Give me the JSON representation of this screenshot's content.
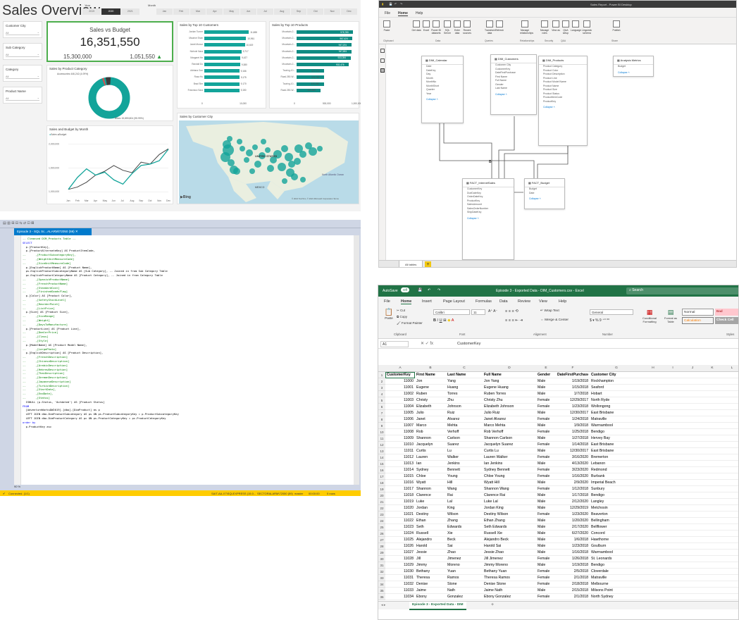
{
  "dashboard": {
    "title": "Sales Overview",
    "year_label": "Year",
    "years": [
      "2019",
      "2020",
      "2021"
    ],
    "year_selected": "2020",
    "month_label": "Month",
    "months": [
      "Jan",
      "Feb",
      "Mar",
      "Apr",
      "May",
      "Jun",
      "Jul",
      "Aug",
      "Sep",
      "Oct",
      "Nov",
      "Dec"
    ],
    "filters": [
      {
        "label": "Customer City",
        "value": "All"
      },
      {
        "label": "Sub Category",
        "value": "All"
      },
      {
        "label": "Category",
        "value": "All"
      },
      {
        "label": "Product Name",
        "value": "All"
      }
    ],
    "kpi": {
      "title": "Sales vs Budget",
      "value": "16,351,550",
      "left": "15,300,000",
      "right": "1,051,550"
    },
    "donut": {
      "title": "Sales by Product Category",
      "label_top": "Accessories 446,242 (4.09%)",
      "label_bottom": "Bikes 15,859,804 (95.99%)"
    },
    "top_customers": {
      "title": "Sales by Top 10 Customers",
      "names": [
        "Jordan Turner",
        "Maurice Shan",
        "Janet Munoz",
        "Nichole Nara",
        "Margaret He",
        "Randall Do",
        "Adriana Gon",
        "Rosa Hu",
        "Brad She",
        "Francisco Sara"
      ],
      "labels": [
        "11,688",
        "10,961",
        "10,619",
        "9,717",
        "9,427",
        "9,380",
        "9,166",
        "9,175",
        "9,170",
        "9,150"
      ],
      "values": [
        11688,
        10961,
        10619,
        9717,
        9427,
        9380,
        9166,
        9175,
        9170,
        9150
      ],
      "axis": [
        "0",
        "10,000"
      ]
    },
    "top_products": {
      "title": "Sales by Top 10 Products",
      "names": [
        "Mountain-2...",
        "Mountain-2...",
        "Mountain-2...",
        "Mountain-2...",
        "Mountain-2...",
        "Mountain-2...",
        "Touring-10...",
        "Road-350-W...",
        "Touring-10...",
        "Road-350-W..."
      ],
      "labels": [
        "978,780",
        "967,424",
        "947,201",
        "947,651",
        "933,394",
        "902,476",
        "477,772",
        "474,790",
        "470,940",
        "409,660"
      ],
      "values": [
        978780,
        967424,
        947201,
        947651,
        933394,
        902476,
        477772,
        474790,
        470940,
        409660
      ],
      "axis": [
        "0",
        "500,000",
        "1,000,000"
      ]
    },
    "line": {
      "title": "Sales and Budget by Month",
      "legend": [
        "Sales",
        "Budget"
      ],
      "y_ticks": [
        "2,000,000",
        "1,500,000",
        "1,000,000"
      ],
      "sales": [
        1050000,
        1300000,
        1480000,
        1350000,
        1410000,
        1250000,
        1160000,
        1380000,
        1550000,
        1580000,
        1650000,
        1890000
      ],
      "budget": [
        1050000,
        1100000,
        1200000,
        1350000,
        1430000,
        1550000,
        1450000,
        1400000,
        1620000,
        1580000,
        1780000,
        1900000
      ]
    },
    "map": {
      "title": "Sales by Customer City",
      "country": "UNITED STATES",
      "mexico": "MEXICO",
      "ocean": "North Atlantic Ocean",
      "brand": "Bing",
      "copyright": "© 2021 TomTom, © 2021 Microsoft Corporation Terms"
    }
  },
  "powerbi": {
    "window_title": "Sales Report - Power BI Desktop",
    "menu": [
      "File",
      "Home",
      "Help"
    ],
    "ribbon": [
      "Paste",
      "Get data",
      "Excel",
      "Power BI datasets",
      "SQL Server",
      "Enter data",
      "Recent sources",
      "Transform data",
      "Refresh",
      "Manage relationships",
      "Manage roles",
      "View as",
      "Q&A setup",
      "Language",
      "Linguistic schema",
      "Publish"
    ],
    "groups": [
      "Clipboard",
      "Data",
      "Queries",
      "Relationships",
      "Security",
      "Q&A",
      "Share"
    ],
    "tables": [
      {
        "name": "DIM_Calendar",
        "fields": [
          "Date",
          "DateKey",
          "Day",
          "Month",
          "MonthNo",
          "MonthShort",
          "Quarter",
          "Year"
        ]
      },
      {
        "name": "DIM_Customers",
        "fields": [
          "Customer City",
          "CustomerKey",
          "DateFirstPurchase",
          "First Name",
          "Full Name",
          "Gender",
          "Last Name"
        ]
      },
      {
        "name": "DIM_Products",
        "fields": [
          "Product Category",
          "Product Color",
          "Product Description",
          "Product Line",
          "Product Model Name",
          "Product Name",
          "Product Size",
          "Product Status",
          "ProductItemCode",
          "ProductKey"
        ]
      },
      {
        "name": "Analysis Metrics",
        "fields": [
          "Budget"
        ]
      },
      {
        "name": "FACT_InternetSales",
        "fields": [
          "CustomerKey",
          "DueDateKey",
          "OrderDateKey",
          "ProductKey",
          "SalesAmount",
          "SalesOrderNumber",
          "ShipDateKey"
        ]
      },
      {
        "name": "FACT_Budget",
        "fields": [
          "Budget",
          "Date"
        ]
      }
    ],
    "collapse": "Collapse",
    "tab": "All tables",
    "add_tab": "+"
  },
  "ssms": {
    "tab": "Episode 3 - SQL Sc...ALARM\\72050 (59)",
    "zoom": "90 %",
    "status_left": "Connected. (1/1)",
    "status_server": "SAIT-AA-X7\\SQLEXPRESS (15.0...",
    "status_user": "SECTORALARM\\72050 (59)",
    "status_db": "master",
    "status_time": "00:00:00",
    "status_rows": "0 rows",
    "code": [
      [
        "gr",
        "-- Cleansed DIM_Products Table --"
      ],
      [
        "kw",
        "SELECT"
      ],
      [
        "",
        "  p.[ProductKey],"
      ],
      [
        "",
        "  p.[ProductAlternateKey] AS ProductItemCode,"
      ],
      [
        "gr",
        "--      ,[ProductSubcategoryKey],"
      ],
      [
        "gr",
        "--      ,[WeightUnitMeasureCode]"
      ],
      [
        "gr",
        "--      ,[SizeUnitMeasureCode]"
      ],
      [
        "",
        "  p.[EnglishProductName] AS [Product Name],"
      ],
      [
        "",
        "  ps.EnglishProductSubcategoryName AS [Sub Category], -- Joined in from Sub Category Table"
      ],
      [
        "",
        "  pc.EnglishProductCategoryName AS [Product Category], -- Joined in from Category Table"
      ],
      [
        "gr",
        "--      ,[SpanishProductName]"
      ],
      [
        "gr",
        "--      ,[FrenchProductName]"
      ],
      [
        "gr",
        "--      ,[StandardCost]"
      ],
      [
        "gr",
        "--      ,[FinishedGoodsFlag]"
      ],
      [
        "",
        "  p.[Color] AS [Product Color],"
      ],
      [
        "gr",
        "--      ,[SafetyStockLevel]"
      ],
      [
        "gr",
        "--      ,[ReorderPoint]"
      ],
      [
        "gr",
        "--      ,[ListPrice]"
      ],
      [
        "",
        "  p.[Size] AS [Product Size],"
      ],
      [
        "gr",
        "--      ,[SizeRange]"
      ],
      [
        "gr",
        "--      ,[Weight]"
      ],
      [
        "gr",
        "--      ,[DaysToManufacture]"
      ],
      [
        "",
        "  p.[ProductLine] AS [Product Line],"
      ],
      [
        "gr",
        "--      ,[DealerPrice]"
      ],
      [
        "gr",
        "--      ,[Class]"
      ],
      [
        "gr",
        "--      ,[Style]"
      ],
      [
        "",
        "  p.[ModelName] AS [Product Model Name],"
      ],
      [
        "gr",
        "--      ,[LargePhoto]"
      ],
      [
        "",
        "  p.[EnglishDescription] AS [Product Description],"
      ],
      [
        "gr",
        "--      ,[FrenchDescription]"
      ],
      [
        "gr",
        "--      ,[ChineseDescription]"
      ],
      [
        "gr",
        "--      ,[ArabicDescription]"
      ],
      [
        "gr",
        "--      ,[HebrewDescription]"
      ],
      [
        "gr",
        "--      ,[ThaiDescription]"
      ],
      [
        "gr",
        "--      ,[GermanDescription]"
      ],
      [
        "gr",
        "--      ,[JapaneseDescription]"
      ],
      [
        "gr",
        "--      ,[TurkishDescription]"
      ],
      [
        "gr",
        "--      ,[StartDate],"
      ],
      [
        "gr",
        "--      ,[EndDate],"
      ],
      [
        "gr",
        "--      ,[Status]"
      ],
      [
        "",
        "  ISNULL (p.Status, 'Outdated') AS [Product Status]"
      ],
      [
        "kw",
        "FROM"
      ],
      [
        "",
        "  [AdventureWorksDW2019].[dbo].[DimProduct] as p"
      ],
      [
        "",
        "  LEFT JOIN dbo.DimProductSubcategory AS ps ON ps.ProductSubcategoryKey = p.ProductSubcategoryKey"
      ],
      [
        "",
        "  LEFT JOIN dbo.DimProductCategory AS pc ON ps.ProductCategoryKey = pc.ProductCategoryKey"
      ],
      [
        "kw",
        "order by"
      ],
      [
        "",
        "  p.ProductKey asc"
      ]
    ]
  },
  "excel": {
    "autosave": "AutoSave",
    "autosave_state": "Off",
    "window_title": "Episode 3 - Exported Data - DIM_Customers.csv - Excel",
    "search": "Search",
    "menu": [
      "File",
      "Home",
      "Insert",
      "Page Layout",
      "Formulas",
      "Data",
      "Review",
      "View",
      "Help"
    ],
    "clipboard": [
      "Paste",
      "Cut",
      "Copy",
      "Format Painter"
    ],
    "font_name": "Calibri",
    "font_size": "11",
    "wrap": "Wrap Text",
    "merge": "Merge & Center",
    "number_format": "General",
    "cond_format": "Conditional Formatting",
    "format_table": "Format as Table",
    "styles": {
      "normal": "Normal",
      "bad": "Bad",
      "calc": "Calculation",
      "check": "Check Cell"
    },
    "groups": [
      "Clipboard",
      "Font",
      "Alignment",
      "Number",
      "Styles"
    ],
    "name_box": "A1",
    "formula": "CustomerKey",
    "columns": [
      "A",
      "B",
      "C",
      "D",
      "E",
      "F",
      "G",
      "H",
      "I",
      "J",
      "K",
      "L"
    ],
    "headers": [
      "CustomerKey",
      "First Name",
      "Last Name",
      "Full Name",
      "Gender",
      "DateFirstPurchase",
      "Customer City"
    ],
    "rows": [
      [
        "11000",
        "Jon",
        "Yang",
        "Jon Yang",
        "Male",
        "1/19/2018",
        "Rockhampton"
      ],
      [
        "11001",
        "Eugene",
        "Huang",
        "Eugene Huang",
        "Male",
        "1/15/2018",
        "Seaford"
      ],
      [
        "11002",
        "Ruben",
        "Torres",
        "Ruben Torres",
        "Male",
        "1/7/2018",
        "Hobart"
      ],
      [
        "11003",
        "Christy",
        "Zhu",
        "Christy Zhu",
        "Female",
        "12/29/2017",
        "North Ryde"
      ],
      [
        "11004",
        "Elizabeth",
        "Johnson",
        "Elizabeth Johnson",
        "Female",
        "1/23/2018",
        "Wollongong"
      ],
      [
        "11005",
        "Julio",
        "Ruiz",
        "Julio Ruiz",
        "Male",
        "12/30/2017",
        "East Brisbane"
      ],
      [
        "11006",
        "Janet",
        "Alvarez",
        "Janet Alvarez",
        "Female",
        "1/24/2018",
        "Matraville"
      ],
      [
        "11007",
        "Marco",
        "Mehta",
        "Marco Mehta",
        "Male",
        "1/9/2018",
        "Warrnambool"
      ],
      [
        "11008",
        "Rob",
        "Verhoff",
        "Rob Verhoff",
        "Female",
        "1/25/2018",
        "Bendigo"
      ],
      [
        "11009",
        "Shannon",
        "Carlson",
        "Shannon Carlson",
        "Male",
        "1/27/2018",
        "Hervey Bay"
      ],
      [
        "11010",
        "Jacquelyn",
        "Suarez",
        "Jacquelyn Suarez",
        "Female",
        "1/14/2018",
        "East Brisbane"
      ],
      [
        "11011",
        "Curtis",
        "Lu",
        "Curtis Lu",
        "Male",
        "12/30/2017",
        "East Brisbane"
      ],
      [
        "11012",
        "Lauren",
        "Walker",
        "Lauren Walker",
        "Female",
        "3/16/2020",
        "Bremerton"
      ],
      [
        "11013",
        "Ian",
        "Jenkins",
        "Ian Jenkins",
        "Male",
        "4/13/2020",
        "Lebanon"
      ],
      [
        "11014",
        "Sydney",
        "Bennett",
        "Sydney Bennett",
        "Female",
        "3/23/2020",
        "Redmond"
      ],
      [
        "11015",
        "Chloe",
        "Young",
        "Chloe Young",
        "Female",
        "1/16/2020",
        "Burbank"
      ],
      [
        "11016",
        "Wyatt",
        "Hill",
        "Wyatt Hill",
        "Male",
        "2/9/2020",
        "Imperial Beach"
      ],
      [
        "11017",
        "Shannon",
        "Wang",
        "Shannon Wang",
        "Female",
        "1/12/2018",
        "Sunbury"
      ],
      [
        "11018",
        "Clarence",
        "Rai",
        "Clarence Rai",
        "Male",
        "1/17/2018",
        "Bendigo"
      ],
      [
        "11019",
        "Luke",
        "Lal",
        "Luke Lal",
        "Male",
        "2/12/2020",
        "Langley"
      ],
      [
        "11020",
        "Jordan",
        "King",
        "Jordan King",
        "Male",
        "12/29/2019",
        "Metchosin"
      ],
      [
        "11021",
        "Destiny",
        "Wilson",
        "Destiny Wilson",
        "Female",
        "1/23/2020",
        "Beaverton"
      ],
      [
        "11022",
        "Ethan",
        "Zhang",
        "Ethan Zhang",
        "Male",
        "1/20/2020",
        "Bellingham"
      ],
      [
        "11023",
        "Seth",
        "Edwards",
        "Seth Edwards",
        "Male",
        "2/17/2020",
        "Bellflower"
      ],
      [
        "11024",
        "Russell",
        "Xie",
        "Russell Xie",
        "Male",
        "6/27/2020",
        "Concord"
      ],
      [
        "11025",
        "Alejandro",
        "Beck",
        "Alejandro Beck",
        "Male",
        "1/6/2018",
        "Hawthorne"
      ],
      [
        "11026",
        "Harold",
        "Sai",
        "Harold Sai",
        "Male",
        "1/23/2018",
        "Goulburn"
      ],
      [
        "11027",
        "Jessie",
        "Zhao",
        "Jessie Zhao",
        "Male",
        "1/16/2018",
        "Warrnambool"
      ],
      [
        "11028",
        "Jill",
        "Jimenez",
        "Jill Jimenez",
        "Female",
        "1/26/2018",
        "St. Leonards"
      ],
      [
        "11029",
        "Jimmy",
        "Moreno",
        "Jimmy Moreno",
        "Male",
        "1/19/2018",
        "Bendigo"
      ],
      [
        "11030",
        "Bethany",
        "Yuan",
        "Bethany Yuan",
        "Female",
        "2/5/2018",
        "Cloverdale"
      ],
      [
        "11031",
        "Theresa",
        "Ramos",
        "Theresa Ramos",
        "Female",
        "2/1/2018",
        "Matraville"
      ],
      [
        "11032",
        "Denise",
        "Stone",
        "Denise Stone",
        "Female",
        "2/18/2018",
        "Melbourne"
      ],
      [
        "11033",
        "Jaime",
        "Nath",
        "Jaime Nath",
        "Male",
        "2/15/2018",
        "Milsons Point"
      ],
      [
        "11034",
        "Ebony",
        "Gonzalez",
        "Ebony Gonzalez",
        "Female",
        "2/1/2018",
        "North Sydney"
      ]
    ],
    "sheet_tab": "Episode 3 - Exported Data - DIM",
    "add_sheet": "+"
  }
}
